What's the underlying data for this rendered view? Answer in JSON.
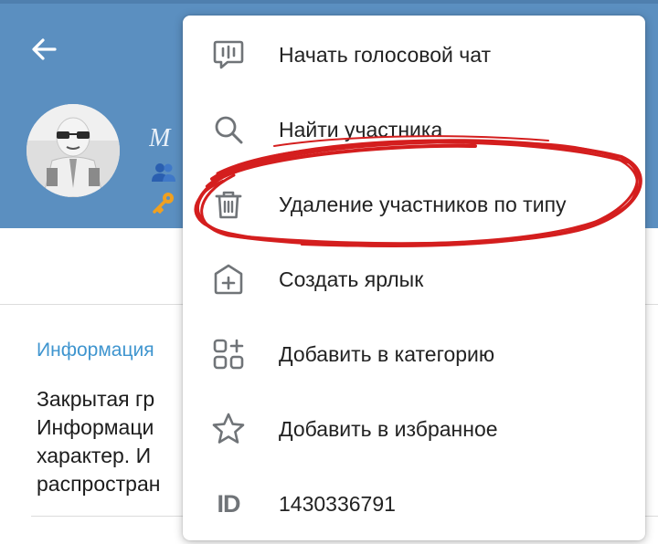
{
  "header": {
    "group_title": "М",
    "accent": "#5b8fc0"
  },
  "info": {
    "section_label": "Информация",
    "description_lines": [
      "Закрытая гр",
      "Информаци",
      "характер. И",
      "распростран"
    ]
  },
  "menu": {
    "items": [
      {
        "label": "Начать голосовой чат",
        "icon": "voice-chat-icon"
      },
      {
        "label": "Найти участника",
        "icon": "search-icon"
      },
      {
        "label": "Удаление участников по типу",
        "icon": "trash-icon"
      },
      {
        "label": "Создать ярлык",
        "icon": "add-shortcut-icon"
      },
      {
        "label": "Добавить в категорию",
        "icon": "add-category-icon"
      },
      {
        "label": "Добавить в избранное",
        "icon": "star-icon"
      },
      {
        "label": "1430336791",
        "icon": "id-icon",
        "icon_text": "ID"
      }
    ]
  },
  "annotation": {
    "color": "#d41e1e",
    "highlighted_item": "Удаление участников по типу"
  }
}
